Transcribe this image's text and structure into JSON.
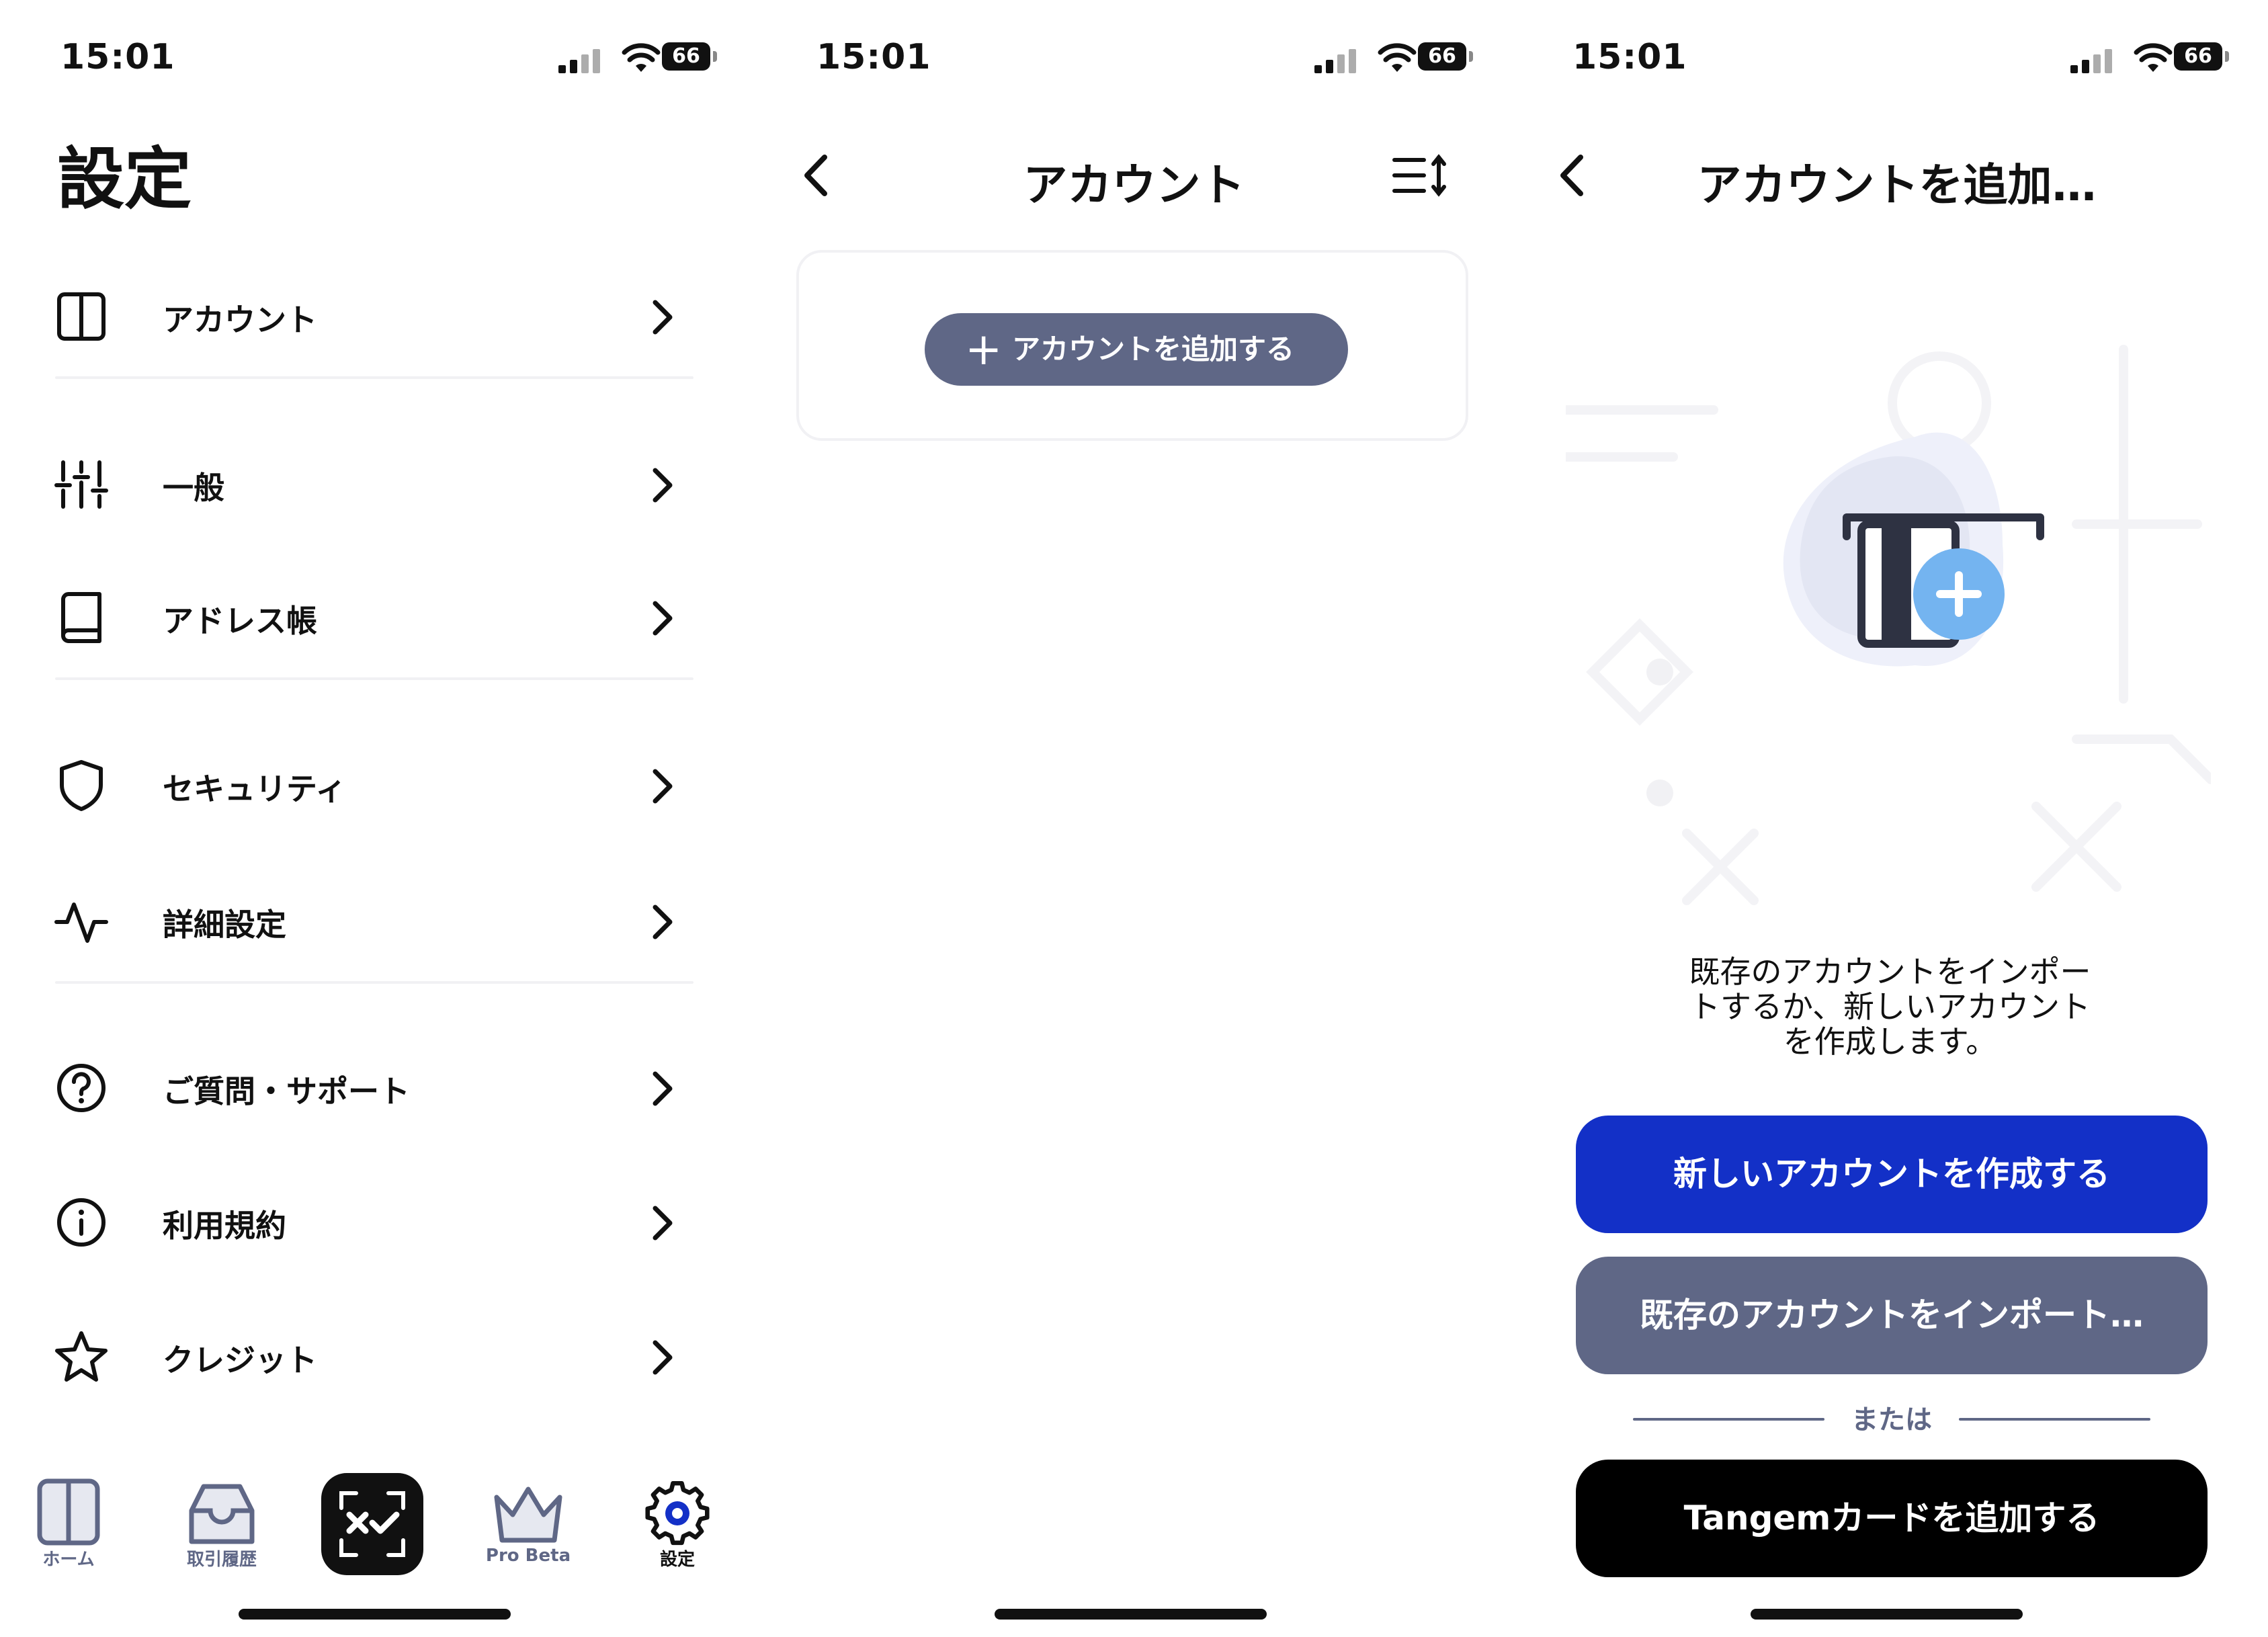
{
  "status_bar": {
    "time": "15:01",
    "battery": "66"
  },
  "settings": {
    "title": "設定",
    "items": [
      {
        "label": "アカウント",
        "icon": "columns-icon"
      },
      {
        "label": "一般",
        "icon": "sliders-icon"
      },
      {
        "label": "アドレス帳",
        "icon": "book-icon"
      },
      {
        "label": "セキュリティ",
        "icon": "shield-icon"
      },
      {
        "label": "詳細設定",
        "icon": "activity-icon"
      },
      {
        "label": "ご質問・サポート",
        "icon": "help-circle-icon"
      },
      {
        "label": "利用規約",
        "icon": "info-icon"
      },
      {
        "label": "クレジット",
        "icon": "star-icon"
      }
    ],
    "tabs": [
      {
        "label": "ホーム",
        "icon": "home-columns-icon"
      },
      {
        "label": "取引履歴",
        "icon": "inbox-icon"
      },
      {
        "label": "",
        "icon": "scan-check-icon"
      },
      {
        "label": "Pro Beta",
        "icon": "crown-icon"
      },
      {
        "label": "設定",
        "icon": "gear-icon"
      }
    ]
  },
  "accounts": {
    "title": "アカウント",
    "add_button": "アカウントを追加する",
    "plus": "+"
  },
  "add_account": {
    "title": "アカウントを追加…",
    "description_lines": [
      "既存のアカウントをインポー",
      "トするか、新しいアカウント",
      "を作成します。"
    ],
    "create_button": "新しいアカウントを作成する",
    "import_button": "既存のアカウントをインポート…",
    "or_text": "または",
    "tangem_button": "Tangemカードを追加する",
    "colors": {
      "primary": "#1330c7",
      "secondary": "#5f6786",
      "dark": "#000000",
      "illustration_plus": "#74b4f0"
    }
  }
}
